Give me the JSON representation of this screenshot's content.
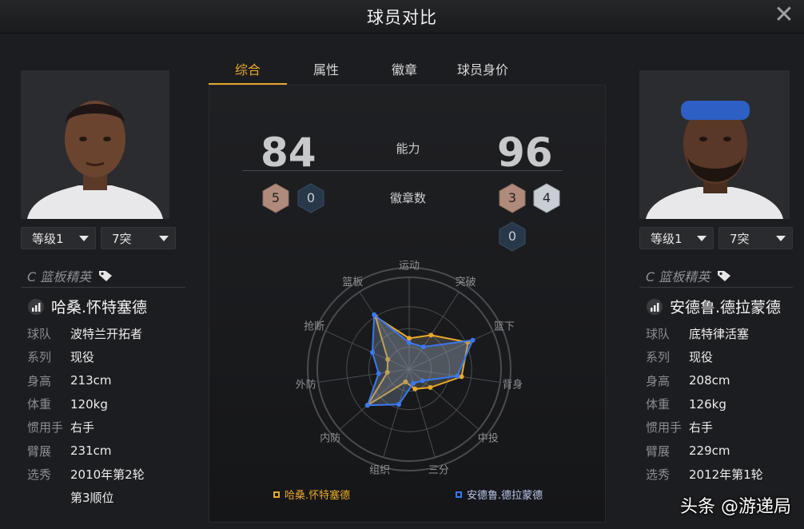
{
  "window": {
    "title": "球员对比",
    "close_label": "✕"
  },
  "tabs": [
    "综合",
    "属性",
    "徽章",
    "球员身价"
  ],
  "active_tab_index": 0,
  "comparison": {
    "ability_label": "能力",
    "badge_count_label": "徽章数",
    "left_rating": "84",
    "right_rating": "96",
    "left_badges": [
      {
        "type": "bronze",
        "count": "5"
      },
      {
        "type": "dark",
        "count": "0"
      }
    ],
    "right_badges": [
      {
        "type": "bronze",
        "count": "3"
      },
      {
        "type": "silver",
        "count": "4"
      },
      {
        "type": "dark",
        "count": "0"
      }
    ]
  },
  "radar": {
    "axes": [
      "运动",
      "突破",
      "篮下",
      "背身",
      "中投",
      "三分",
      "组织",
      "内防",
      "外防",
      "抢断",
      "篮板"
    ],
    "series": [
      {
        "name": "哈桑.怀特塞德",
        "color": "#e8a92a",
        "values": [
          0.42,
          0.55,
          0.88,
          0.72,
          0.38,
          0.28,
          0.18,
          0.75,
          0.3,
          0.32,
          0.85
        ]
      },
      {
        "name": "安德鲁.德拉蒙德",
        "color": "#3a78f0",
        "values": [
          0.36,
          0.36,
          0.95,
          0.66,
          0.24,
          0.2,
          0.5,
          0.75,
          0.42,
          0.55,
          0.88
        ]
      }
    ],
    "colors": {
      "grid": "#4a4c50",
      "bronze_fill": "#b08a7a",
      "silver_fill": "#c9ced6",
      "dark_fill": "#27384a"
    }
  },
  "left_player": {
    "level_select": "等级1",
    "breakthrough_select": "7突",
    "position_tag": "C 篮板精英",
    "name": "哈桑.怀特塞德",
    "stats": [
      {
        "label": "球队",
        "value": "波特兰开拓者"
      },
      {
        "label": "系列",
        "value": "现役"
      },
      {
        "label": "身高",
        "value": "213cm"
      },
      {
        "label": "体重",
        "value": "120kg"
      },
      {
        "label": "惯用手",
        "value": "右手"
      },
      {
        "label": "臂展",
        "value": "231cm"
      },
      {
        "label": "选秀",
        "value": "2010年第2轮"
      }
    ],
    "draft_extra": "第3顺位"
  },
  "right_player": {
    "level_select": "等级1",
    "breakthrough_select": "7突",
    "position_tag": "C 篮板精英",
    "name": "安德鲁.德拉蒙德",
    "stats": [
      {
        "label": "球队",
        "value": "底特律活塞"
      },
      {
        "label": "系列",
        "value": "现役"
      },
      {
        "label": "身高",
        "value": "208cm"
      },
      {
        "label": "体重",
        "value": "126kg"
      },
      {
        "label": "惯用手",
        "value": "右手"
      },
      {
        "label": "臂展",
        "value": "229cm"
      },
      {
        "label": "选秀",
        "value": "2012年第1轮"
      }
    ]
  },
  "watermark": "头条 @游递局"
}
